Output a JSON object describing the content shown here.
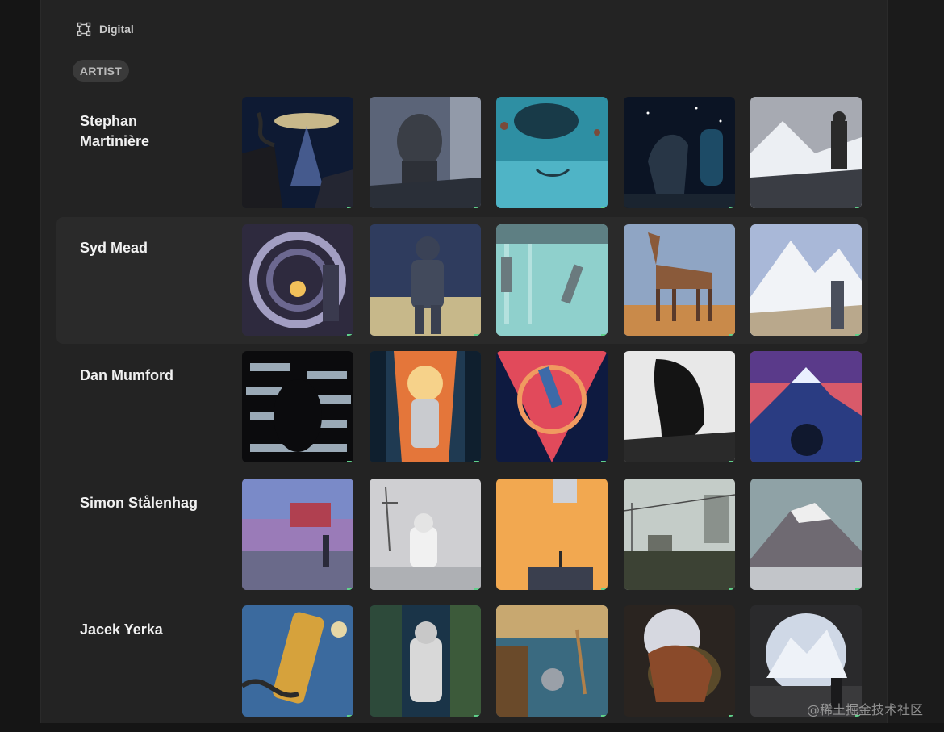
{
  "header": {
    "category_label": "Digital",
    "category_icon": "frame-icon",
    "filter_label": "ARTIST"
  },
  "colors": {
    "panel": "#232323",
    "background": "#151515",
    "highlight_row": "#2a2a2a",
    "pill": "#3a3a3a",
    "accent_tick": "#5fd08a"
  },
  "artists": [
    {
      "name": "Stephan Martinière"
    },
    {
      "name": "Syd Mead"
    },
    {
      "name": "Dan Mumford"
    },
    {
      "name": "Simon Stålenhag"
    },
    {
      "name": "Jacek Yerka"
    }
  ],
  "watermark": "@稀土掘金技术社区"
}
